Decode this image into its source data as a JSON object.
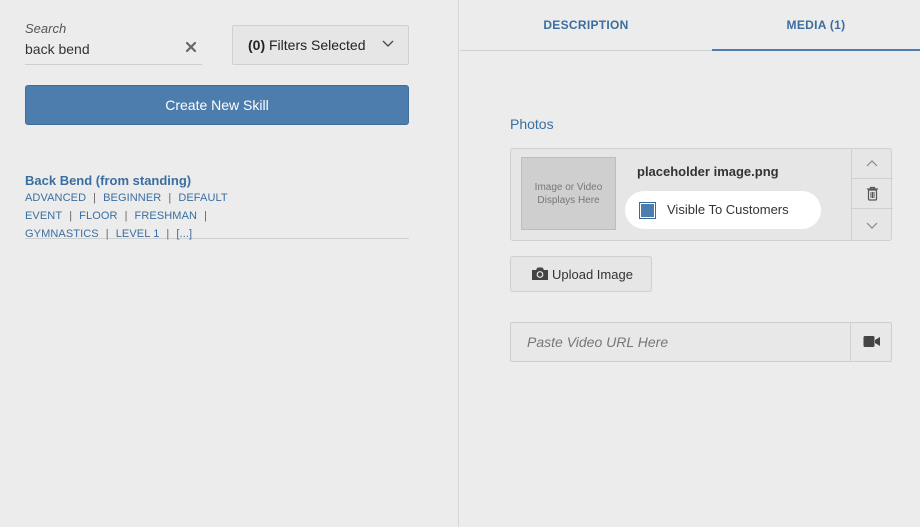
{
  "search": {
    "label": "Search",
    "value": "back bend"
  },
  "filters": {
    "count": "(0)",
    "text": "Filters Selected"
  },
  "create_button": "Create New Skill",
  "skill": {
    "title": "Back Bend (from standing)",
    "tags": [
      "ADVANCED",
      "BEGINNER",
      "DEFAULT EVENT",
      "FLOOR",
      "FRESHMAN",
      "GYMNASTICS",
      "LEVEL 1",
      "[...]"
    ]
  },
  "tabs": {
    "description": "DESCRIPTION",
    "media": "MEDIA (1)"
  },
  "photos": {
    "title": "Photos",
    "thumb_placeholder": "Image or Video Displays Here",
    "filename": "placeholder image.png",
    "visible_label": "Visible To Customers",
    "visible_checked": true
  },
  "upload_button": "Upload Image",
  "video": {
    "placeholder": "Paste Video URL Here"
  },
  "colors": {
    "accent": "#4c7dac",
    "link": "#3b6ea0",
    "background": "#ececec"
  }
}
